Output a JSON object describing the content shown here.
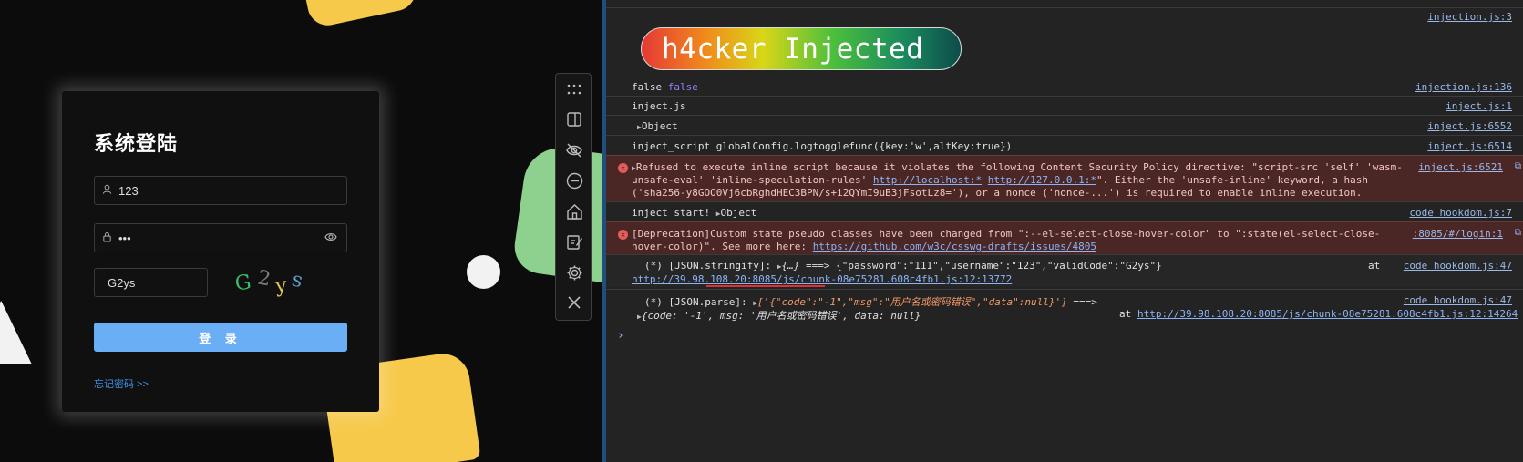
{
  "login": {
    "title": "系统登陆",
    "username_value": "123",
    "password_value": "•••",
    "code_value": "G2ys",
    "captcha_chars": [
      {
        "ch": "G",
        "color": "#3bbd6a"
      },
      {
        "ch": "2",
        "color": "#7a7a7a"
      },
      {
        "ch": "y",
        "color": "#e2c74a"
      },
      {
        "ch": "s",
        "color": "#5aa0c8"
      }
    ],
    "login_label": "登 录",
    "forgot_label": "忘记密码 >>"
  },
  "toolbar": {
    "icons": [
      "drag-handle-icon",
      "panel-icon",
      "eye-off-icon",
      "minus-circle-icon",
      "home-icon",
      "edit-icon",
      "gear-icon",
      "close-icon"
    ]
  },
  "console": {
    "banner": "h4cker Injected",
    "rows": [
      {
        "source": "injection.js:3"
      },
      {
        "msg_a": "false",
        "msg_b": "false",
        "source": "injection.js:136"
      },
      {
        "msg": "inject.js",
        "source": "inject.js:1"
      },
      {
        "msg": "Object",
        "source": "inject.js:6552"
      },
      {
        "msg": "inject_script globalConfig.logtogglefunc({key:'w',altKey:true})",
        "source": "inject.js:6514"
      },
      {
        "line1": "Refused to execute inline script because it violates the following Content Security Policy directive: \"script-src 'self' 'wasm-",
        "line2_a": "unsafe-eval' 'inline-speculation-rules'",
        "link_a": "http://localhost:*",
        "link_b": "http://127.0.0.1:*",
        "line2_b": "\". Either the 'unsafe-inline' keyword, a hash",
        "line3": "('sha256-y8GOO0Vj6cbRghdHEC3BPN/s+i2QYmI9uB3jFsotLz8='), or a nonce ('nonce-...') is required to enable inline execution.",
        "source": "inject.js:6521"
      },
      {
        "msg_a": "inject start!",
        "msg_b": "Object",
        "source": "code hookdom.js:7"
      },
      {
        "line1": "[Deprecation]Custom state pseudo classes have been changed from \":--el-select-close-hover-color\" to \":state(el-select-close-",
        "line2": "hover-color)\". See more here:",
        "link": "https://github.com/w3c/csswg-drafts/issues/4805",
        "source": ":8085/#/login:1"
      },
      {
        "msg_a": "(*) [JSON.stringify]:",
        "msg_obj": "{…}",
        "msg_b": "===> {\"password\":\"111\",\"username\":\"123\",\"validCode\":\"G2ys\"}",
        "at": "at",
        "link": "http://39.98.108.20:8085/js/chunk-08e75281.608c4fb1.js:12:13772",
        "source": "code hookdom.js:47"
      },
      {
        "msg_a": "(*) [JSON.parse]:",
        "msg_str": "['{\"code\":\"-1\",\"msg\":\"用户名或密码错误\",\"data\":null}']",
        "msg_b": "===>",
        "line2": "{code: '-1', msg: '用户名或密码错误', data: null}",
        "at": "at",
        "link": "http://39.98.108.20:8085/js/chunk-08e75281.608c4fb1.js:12:14264",
        "source": "code hookdom.js:47"
      }
    ],
    "prompt": "›"
  }
}
